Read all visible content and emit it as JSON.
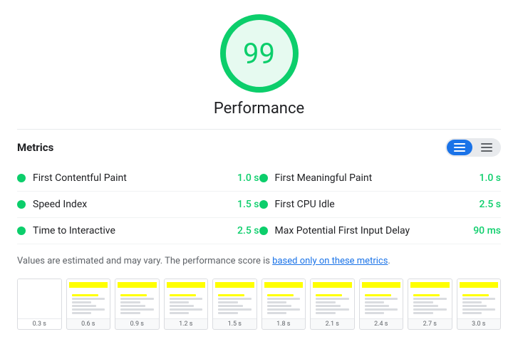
{
  "score": {
    "value": "99",
    "label": "Performance"
  },
  "metrics_header": {
    "title": "Metrics",
    "toggle": {
      "list_label": "list-view",
      "grid_label": "grid-view"
    }
  },
  "metrics": [
    {
      "name": "First Contentful Paint",
      "value": "1.0 s",
      "color": "#0cce6b"
    },
    {
      "name": "First Meaningful Paint",
      "value": "1.0 s",
      "color": "#0cce6b"
    },
    {
      "name": "Speed Index",
      "value": "1.5 s",
      "color": "#0cce6b"
    },
    {
      "name": "First CPU Idle",
      "value": "2.5 s",
      "color": "#0cce6b"
    },
    {
      "name": "Time to Interactive",
      "value": "2.5 s",
      "color": "#0cce6b"
    },
    {
      "name": "Max Potential First Input Delay",
      "value": "90 ms",
      "color": "#0cce6b"
    }
  ],
  "note": {
    "text_before": "Values are estimated and may vary. The performance score is ",
    "link": "based only on these metrics",
    "text_after": "."
  },
  "filmstrip": {
    "frames": [
      {
        "timestamp": "0.3 s"
      },
      {
        "timestamp": "0.6 s"
      },
      {
        "timestamp": "0.9 s"
      },
      {
        "timestamp": "1.2 s"
      },
      {
        "timestamp": "1.5 s"
      },
      {
        "timestamp": "1.8 s"
      },
      {
        "timestamp": "2.1 s"
      },
      {
        "timestamp": "2.4 s"
      },
      {
        "timestamp": "2.7 s"
      },
      {
        "timestamp": "3.0 s"
      }
    ]
  }
}
